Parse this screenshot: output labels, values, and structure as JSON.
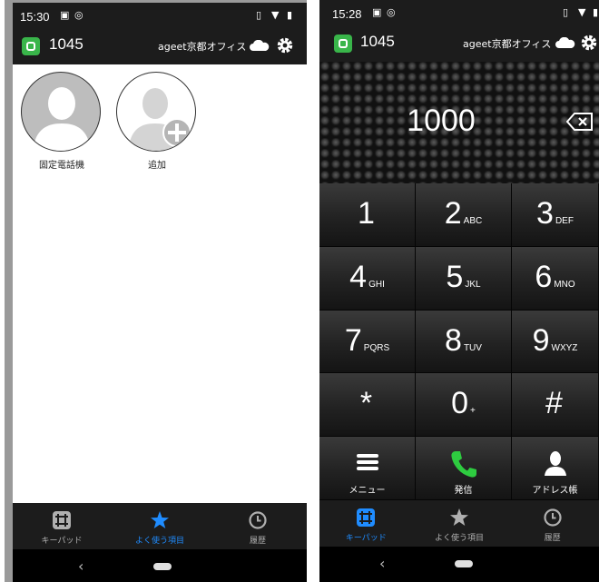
{
  "left_screen": {
    "status": {
      "time": "15:30"
    },
    "header": {
      "extension": "1045",
      "office": "ageet京都オフィス"
    },
    "favorites": [
      {
        "label": "固定電話機",
        "kind": "contact"
      },
      {
        "label": "追加",
        "kind": "add"
      }
    ],
    "tabs": [
      {
        "label": "キーパッド",
        "icon": "keypad-icon",
        "active": false
      },
      {
        "label": "よく使う項目",
        "icon": "star-icon",
        "active": true
      },
      {
        "label": "履歴",
        "icon": "clock-icon",
        "active": false
      }
    ]
  },
  "right_screen": {
    "status": {
      "time": "15:28"
    },
    "header": {
      "extension": "1045",
      "office": "ageet京都オフィス"
    },
    "dialed_number": "1000",
    "keys": [
      {
        "digit": "1",
        "letters": ""
      },
      {
        "digit": "2",
        "letters": "ABC"
      },
      {
        "digit": "3",
        "letters": "DEF"
      },
      {
        "digit": "4",
        "letters": "GHI"
      },
      {
        "digit": "5",
        "letters": "JKL"
      },
      {
        "digit": "6",
        "letters": "MNO"
      },
      {
        "digit": "7",
        "letters": "PQRS"
      },
      {
        "digit": "8",
        "letters": "TUV"
      },
      {
        "digit": "9",
        "letters": "WXYZ"
      },
      {
        "digit": "*",
        "letters": ""
      },
      {
        "digit": "0",
        "letters": "+"
      },
      {
        "digit": "#",
        "letters": ""
      }
    ],
    "actions": {
      "menu": "メニュー",
      "call": "発信",
      "address_book": "アドレス帳"
    },
    "tabs": [
      {
        "label": "キーパッド",
        "icon": "keypad-icon",
        "active": true
      },
      {
        "label": "よく使う項目",
        "icon": "star-icon",
        "active": false
      },
      {
        "label": "履歴",
        "icon": "clock-icon",
        "active": false
      }
    ]
  },
  "colors": {
    "accent": "#1f8cff",
    "call_green": "#2ecc40",
    "logo_green": "#39b54a",
    "bar_bg": "#1c1c1c"
  }
}
